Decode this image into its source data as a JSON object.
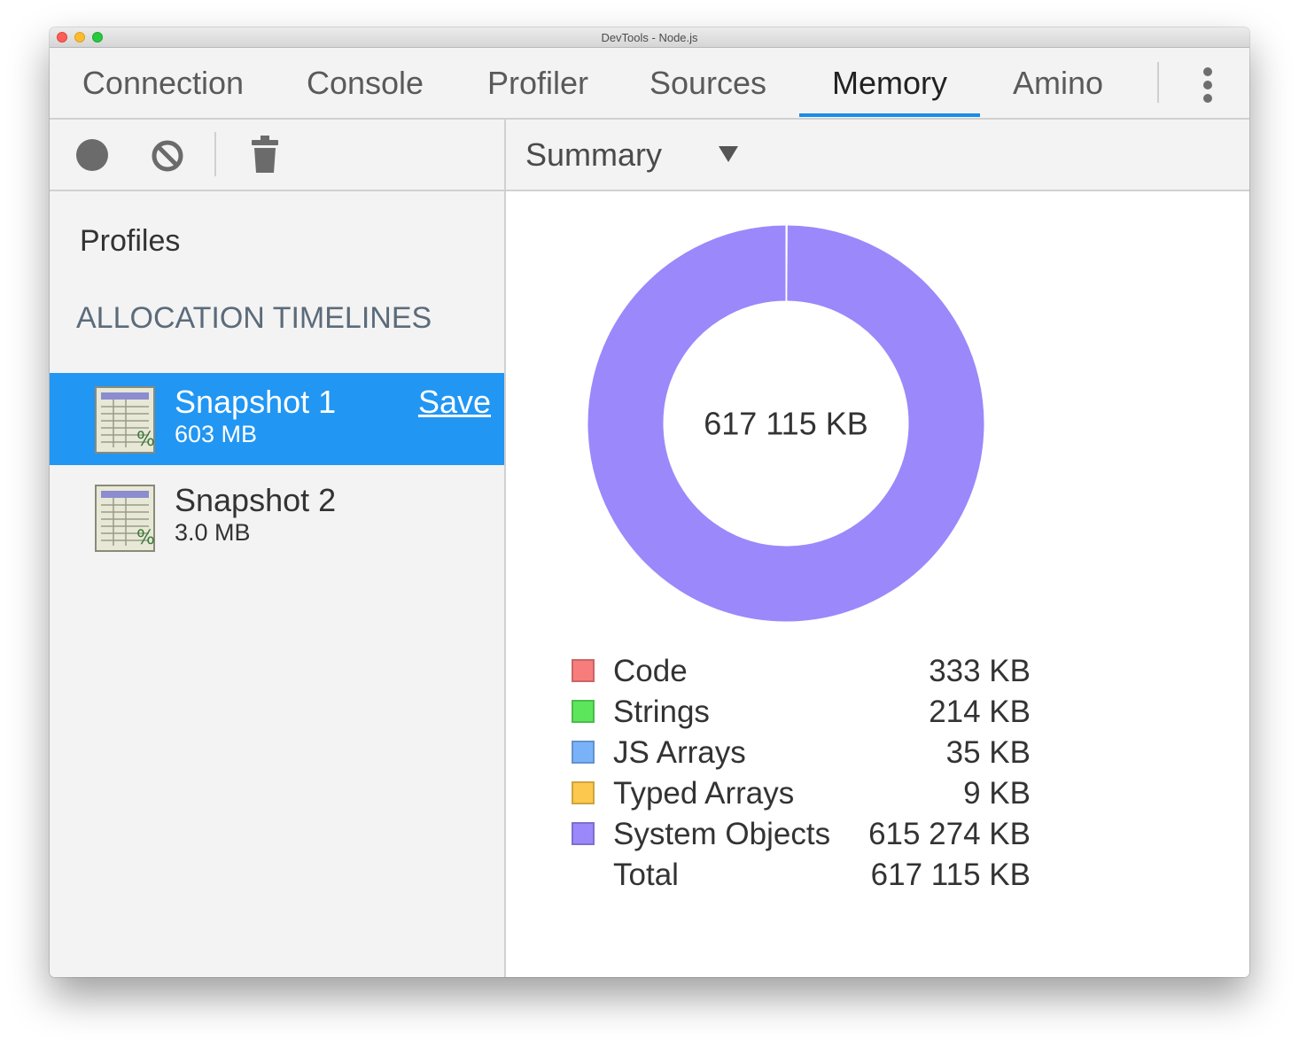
{
  "window": {
    "title": "DevTools - Node.js"
  },
  "tabs": [
    {
      "label": "Connection"
    },
    {
      "label": "Console"
    },
    {
      "label": "Profiler"
    },
    {
      "label": "Sources"
    },
    {
      "label": "Memory",
      "active": true
    },
    {
      "label": "Amino"
    }
  ],
  "toolbar": {
    "view_select": "Summary",
    "icons": [
      "record-icon",
      "clear-icon",
      "trash-icon",
      "dropdown-arrow-icon"
    ]
  },
  "sidebar": {
    "heading": "Profiles",
    "section": "ALLOCATION TIMELINES",
    "snapshots": [
      {
        "title": "Snapshot 1",
        "size": "603 MB",
        "selected": true,
        "action": "Save"
      },
      {
        "title": "Snapshot 2",
        "size": "3.0 MB",
        "selected": false
      }
    ]
  },
  "summary": {
    "center_label": "617 115 KB",
    "legend": [
      {
        "label": "Code",
        "value": "333 KB",
        "color": "#f77d7d"
      },
      {
        "label": "Strings",
        "value": "214 KB",
        "color": "#5ce65c"
      },
      {
        "label": "JS Arrays",
        "value": "35 KB",
        "color": "#7ab2fa"
      },
      {
        "label": "Typed Arrays",
        "value": "9 KB",
        "color": "#fcc84d"
      },
      {
        "label": "System Objects",
        "value": "615 274 KB",
        "color": "#9b88fb"
      }
    ],
    "total": {
      "label": "Total",
      "value": "617 115 KB"
    }
  },
  "chart_data": {
    "type": "pie",
    "categories": [
      "Code",
      "Strings",
      "JS Arrays",
      "Typed Arrays",
      "System Objects"
    ],
    "values": [
      333,
      214,
      35,
      9,
      615274
    ],
    "colors": [
      "#f77d7d",
      "#5ce65c",
      "#7ab2fa",
      "#fcc84d",
      "#9b88fb"
    ]
  }
}
